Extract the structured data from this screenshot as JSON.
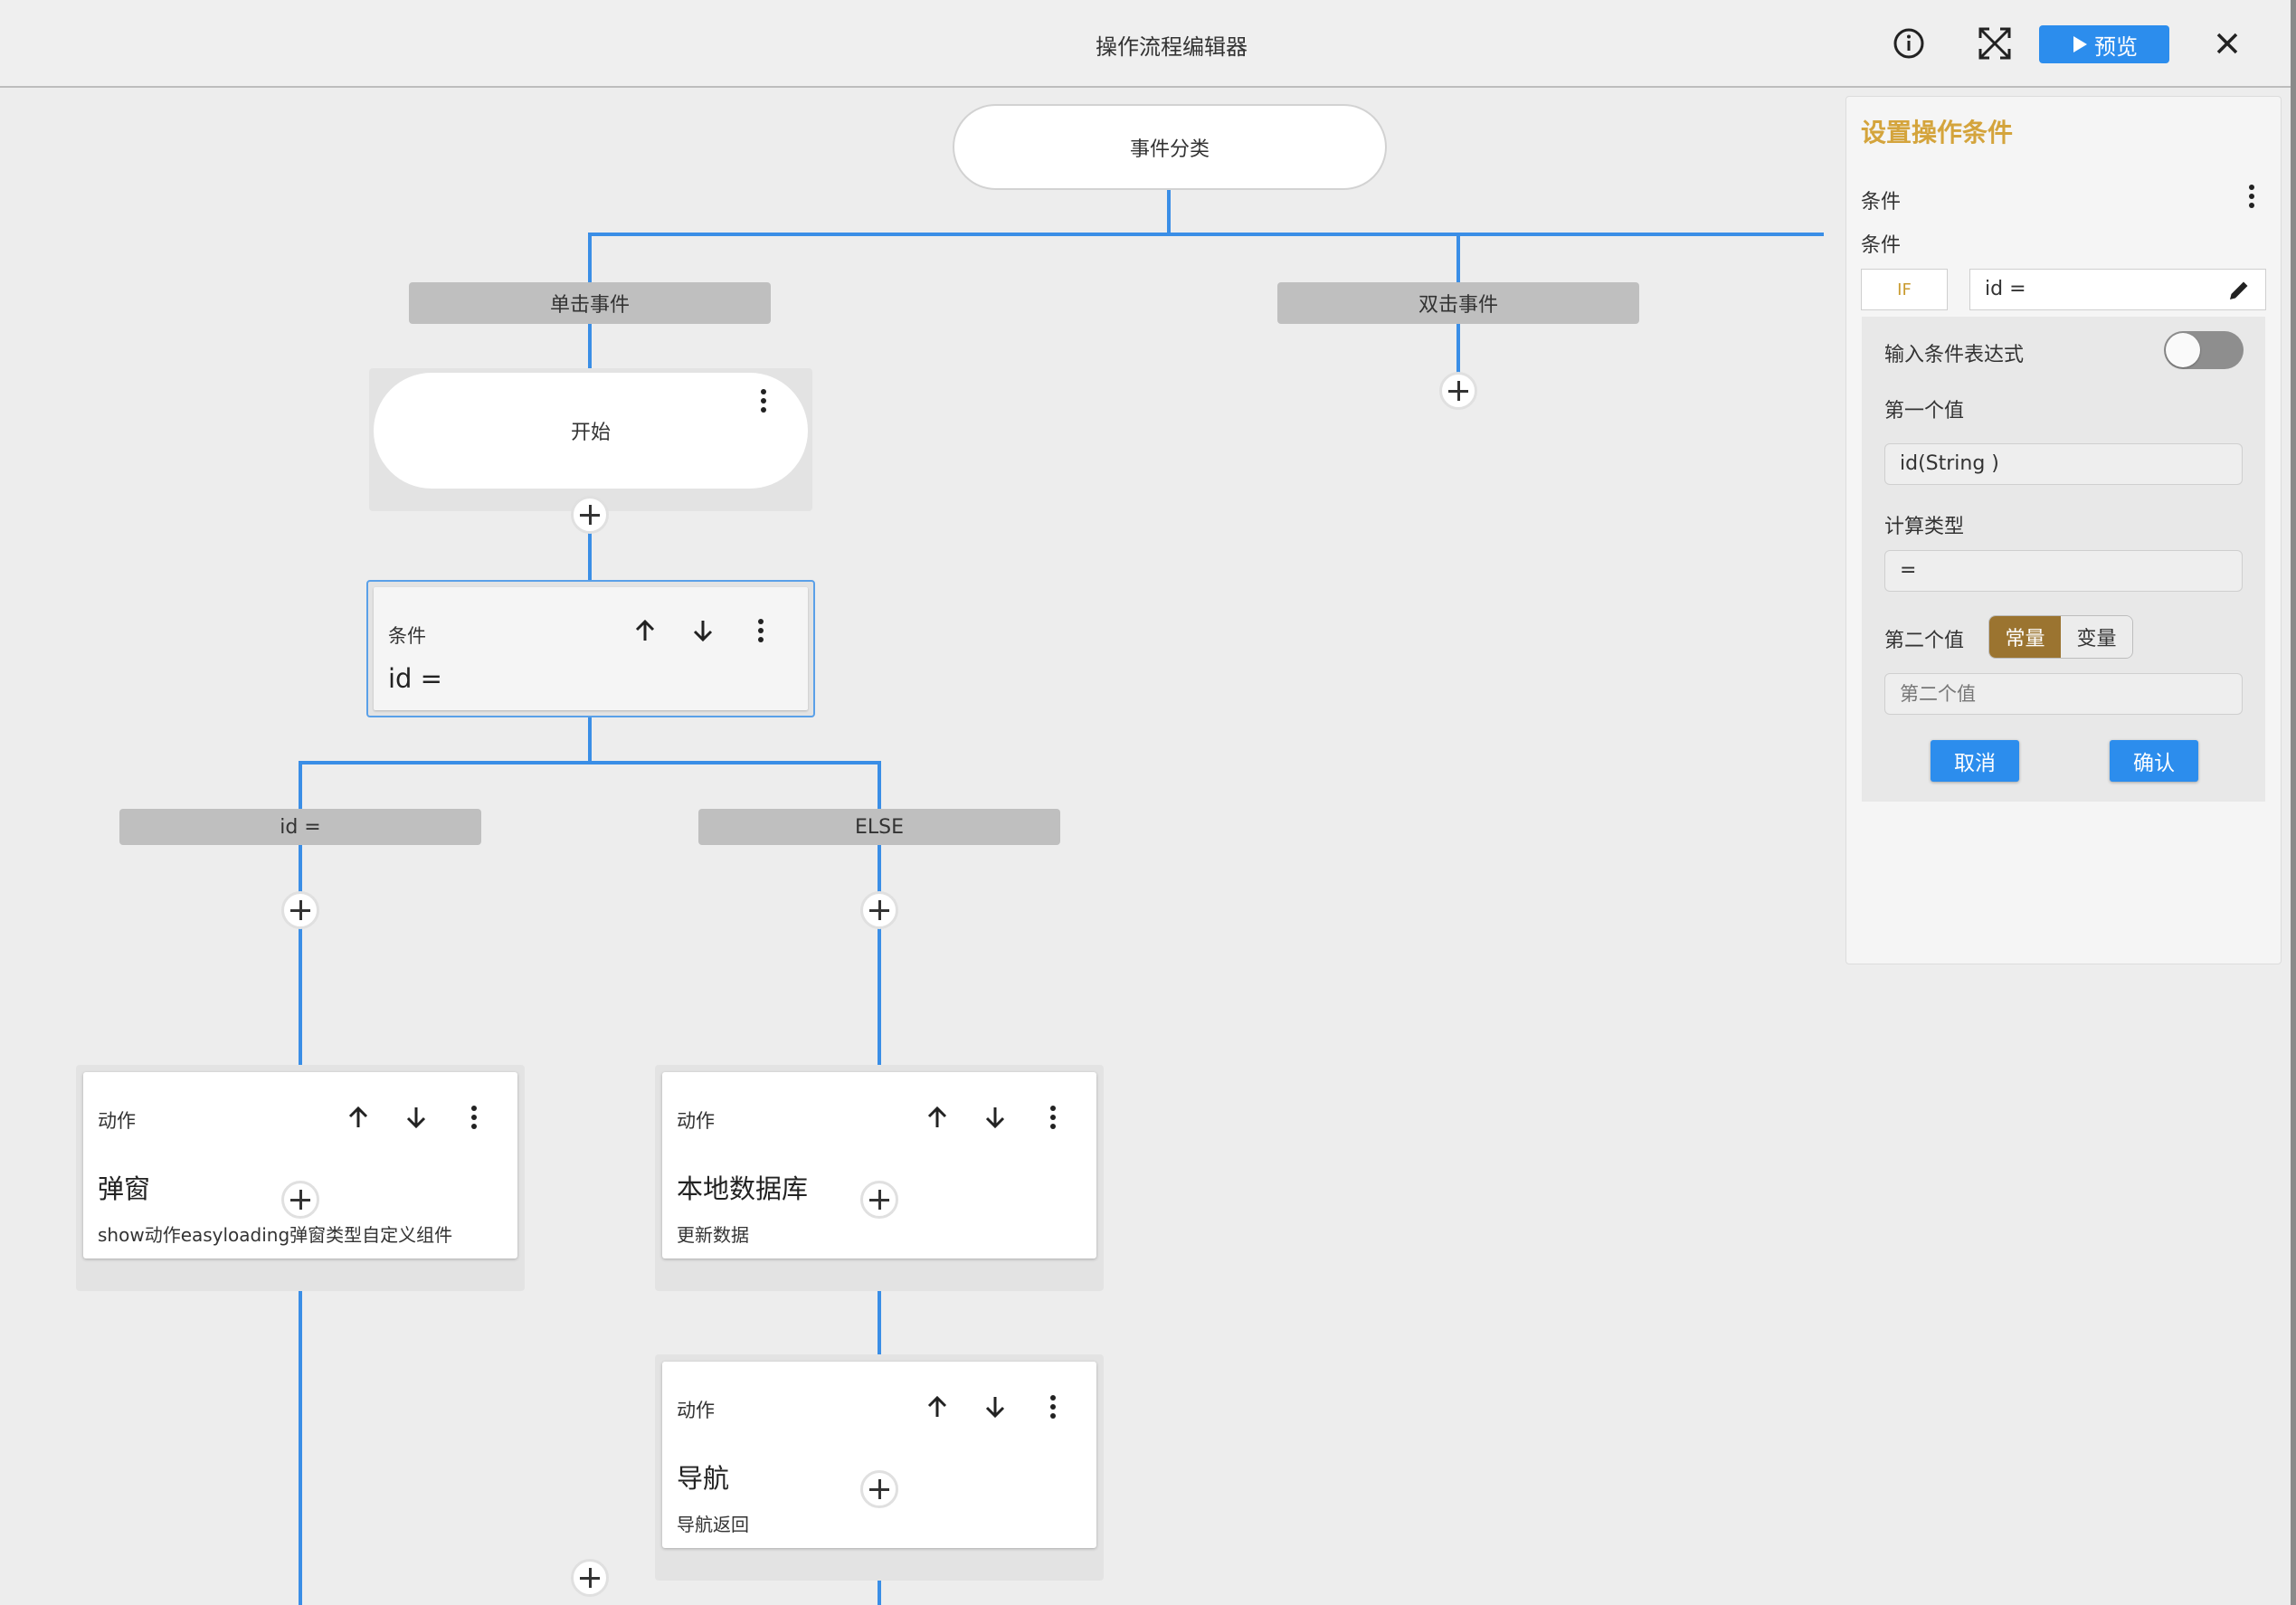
{
  "window": {
    "title": "操作流程编辑器",
    "preview_label": "预览"
  },
  "flow": {
    "root_label": "事件分类",
    "branches": {
      "click": "单击事件",
      "double_click": "双击事件"
    },
    "start_label": "开始",
    "condition_node": {
      "type": "条件",
      "expr": "id ="
    },
    "cond_branches": {
      "if_label": "id =",
      "else_label": "ELSE"
    },
    "actions": [
      {
        "type": "动作",
        "name": "弹窗",
        "desc": "show动作easyloading弹窗类型自定义组件"
      },
      {
        "type": "动作",
        "name": "本地数据库",
        "desc": "更新数据"
      },
      {
        "type": "动作",
        "name": "导航",
        "desc": "导航返回"
      }
    ]
  },
  "side_panel": {
    "title": "设置操作条件",
    "section_label": "条件",
    "condition_label": "条件",
    "if_tag": "IF",
    "condition_value": "id ="
  },
  "condition_popup": {
    "expr_toggle_label": "输入条件表达式",
    "expr_toggle_on": false,
    "first_value_label": "第一个值",
    "first_value": "id(String )",
    "calc_type_label": "计算类型",
    "calc_type": "=",
    "second_value_label": "第二个值",
    "second_value_modes": [
      "常量",
      "变量"
    ],
    "second_value_mode_selected": "常量",
    "second_value_placeholder": "第二个值",
    "cancel_label": "取消",
    "confirm_label": "确认"
  },
  "colors": {
    "accent": "#2c8ded",
    "connector": "#3a8ee6",
    "panel_title": "#d4a43c",
    "segment_selected": "#9b7430"
  }
}
